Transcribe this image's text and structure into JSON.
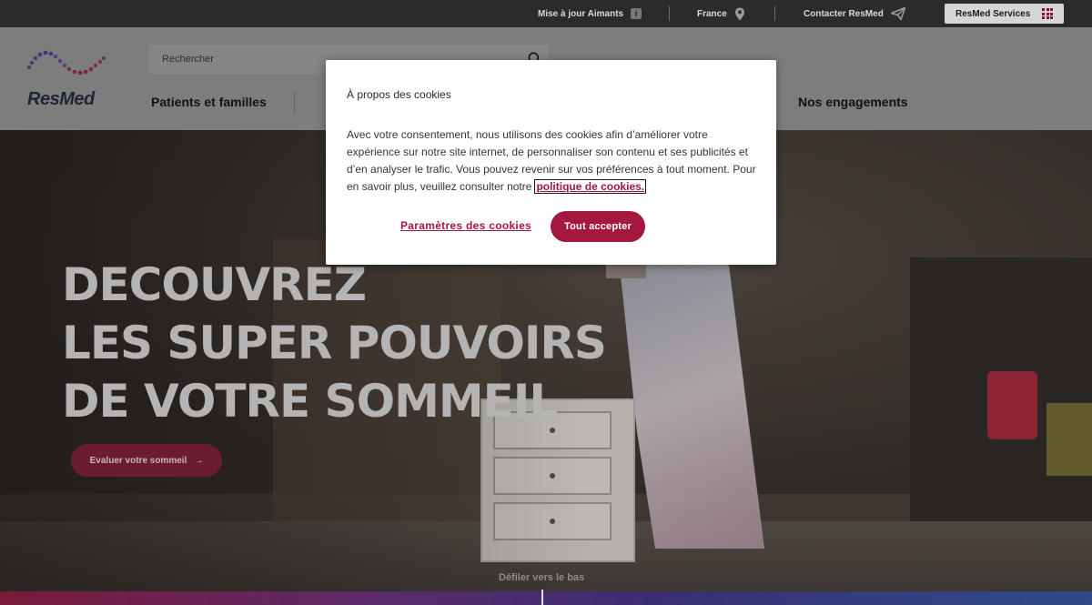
{
  "topbar": {
    "magnets": "Mise à jour Aimants",
    "magnets_info": "i",
    "country": "France",
    "contact": "Contacter ResMed",
    "services": "ResMed Services"
  },
  "header": {
    "logo_text": "ResMed",
    "search_placeholder": "Rechercher",
    "nav": {
      "patients": "Patients et familles",
      "engagements": "Nos engagements"
    }
  },
  "hero": {
    "title_lines": [
      "DECOUVREZ",
      "LES SUPER POUVOIRS",
      "DE VOTRE SOMMEIL"
    ],
    "cta_label": "Evaluer votre sommeil",
    "cta_arrow": "→",
    "scroll_label": "Défiler vers le bas"
  },
  "cookie_modal": {
    "title": "À propos des cookies",
    "body": "Avec votre consentement, nous utilisons des cookies afin d’améliorer votre expérience sur notre site internet, de personnaliser son contenu et ses publicités et d’en analyser le trafic. Vous pouvez revenir sur vos préférences à tout moment. Pour en savoir plus, veuillez consulter notre",
    "policy_link": "politique de cookies.",
    "settings_label": "Paramètres des cookies",
    "accept_label": "Tout accepter"
  },
  "colors": {
    "brand_red": "#a3183e",
    "top_bar": "#2b2b2b"
  },
  "icons": [
    "info-icon",
    "location-pin-icon",
    "paper-plane-icon",
    "grid-icon",
    "search-icon",
    "arrow-right-icon"
  ]
}
